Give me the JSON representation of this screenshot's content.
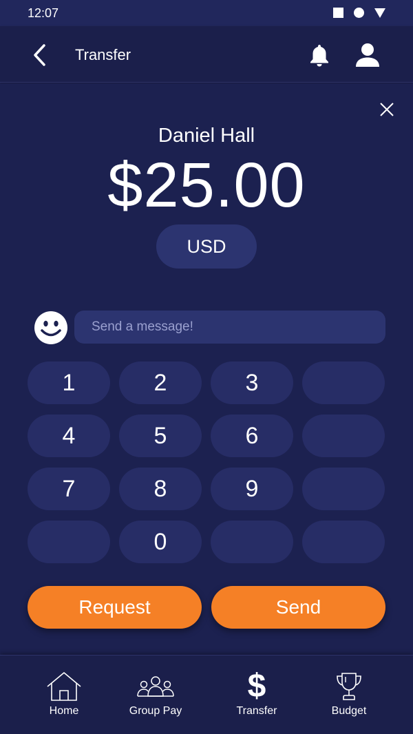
{
  "status_bar": {
    "time": "12:07"
  },
  "header": {
    "title": "Transfer"
  },
  "transfer": {
    "recipient": "Daniel Hall",
    "amount": "$25.00",
    "currency": "USD"
  },
  "message": {
    "placeholder": "Send a message!",
    "value": ""
  },
  "keypad": {
    "keys": [
      "1",
      "2",
      "3",
      "",
      "4",
      "5",
      "6",
      "",
      "7",
      "8",
      "9",
      "",
      "",
      "0",
      "",
      ""
    ]
  },
  "actions": {
    "request_label": "Request",
    "send_label": "Send"
  },
  "nav": {
    "items": [
      {
        "label": "Home",
        "icon": "home-icon"
      },
      {
        "label": "Group Pay",
        "icon": "group-icon"
      },
      {
        "label": "Transfer",
        "icon": "dollar-icon",
        "glyph": "$"
      },
      {
        "label": "Budget",
        "icon": "trophy-icon"
      }
    ]
  },
  "colors": {
    "background": "#1b1f4b",
    "surface": "#2c3470",
    "key": "#272d66",
    "accent": "#f58026"
  }
}
